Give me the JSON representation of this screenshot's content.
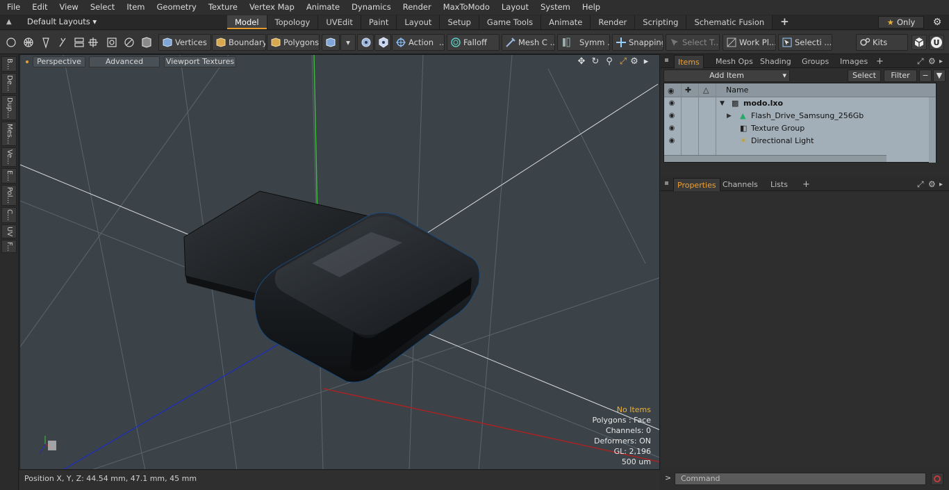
{
  "menu": [
    "File",
    "Edit",
    "View",
    "Select",
    "Item",
    "Geometry",
    "Texture",
    "Vertex Map",
    "Animate",
    "Dynamics",
    "Render",
    "MaxToModo",
    "Layout",
    "System",
    "Help"
  ],
  "layout_dropdown": "Default Layouts",
  "tabs": [
    "Model",
    "Topology",
    "UVEdit",
    "Paint",
    "Layout",
    "Setup",
    "Game Tools",
    "Animate",
    "Render",
    "Scripting",
    "Schematic Fusion"
  ],
  "active_tab": "Model",
  "only_label": "Only",
  "toolbar": {
    "vertices": "Vertices",
    "boundary": "Boundary",
    "polygons": "Polygons",
    "action": "Action",
    "falloff": "Falloff",
    "mesh_c": "Mesh C ...",
    "symm": "Symm ...",
    "snapping": "Snapping",
    "select_t": "Select T...",
    "work_pl": "Work Pl...",
    "selecti": "Selecti ...",
    "kits": "Kits",
    "ellipsis": "..."
  },
  "left_strip": [
    "B...",
    "De...",
    "Dup...",
    "Mes...",
    "Ve...",
    "E...",
    "Pol...",
    "C...",
    "UV",
    "F..."
  ],
  "viewport": {
    "perspective": "Perspective",
    "advanced": "Advanced",
    "viewport_textures": "Viewport Textures",
    "info": {
      "no_items": "No Items",
      "polygons": "Polygons : Face",
      "channels": "Channels: 0",
      "deformers": "Deformers: ON",
      "gl": "GL: 2,196",
      "scale": "500 um"
    }
  },
  "status": {
    "position": "Position X, Y, Z:   44.54 mm, 47.1 mm, 45 mm"
  },
  "right_panel": {
    "tabs": [
      "Items",
      "Mesh Ops",
      "Shading",
      "Groups",
      "Images"
    ],
    "active_tab": "Items",
    "add_item": "Add Item",
    "select": "Select",
    "filter": "Filter",
    "column_name": "Name",
    "tree": [
      {
        "label": "modo.lxo",
        "icon": "scene-icon",
        "bold": true
      },
      {
        "label": "Flash_Drive_Samsung_256Gb",
        "icon": "mesh-icon"
      },
      {
        "label": "Texture Group",
        "icon": "texture-group-icon"
      },
      {
        "label": "Directional Light",
        "icon": "light-icon"
      }
    ],
    "prop_tabs": [
      "Properties",
      "Channels",
      "Lists"
    ],
    "prop_active": "Properties",
    "command_placeholder": "Command"
  },
  "colors": {
    "accent": "#e49a2a",
    "axis_x": "#b02020",
    "axis_y": "#3cc03c",
    "axis_z": "#2030b0"
  }
}
